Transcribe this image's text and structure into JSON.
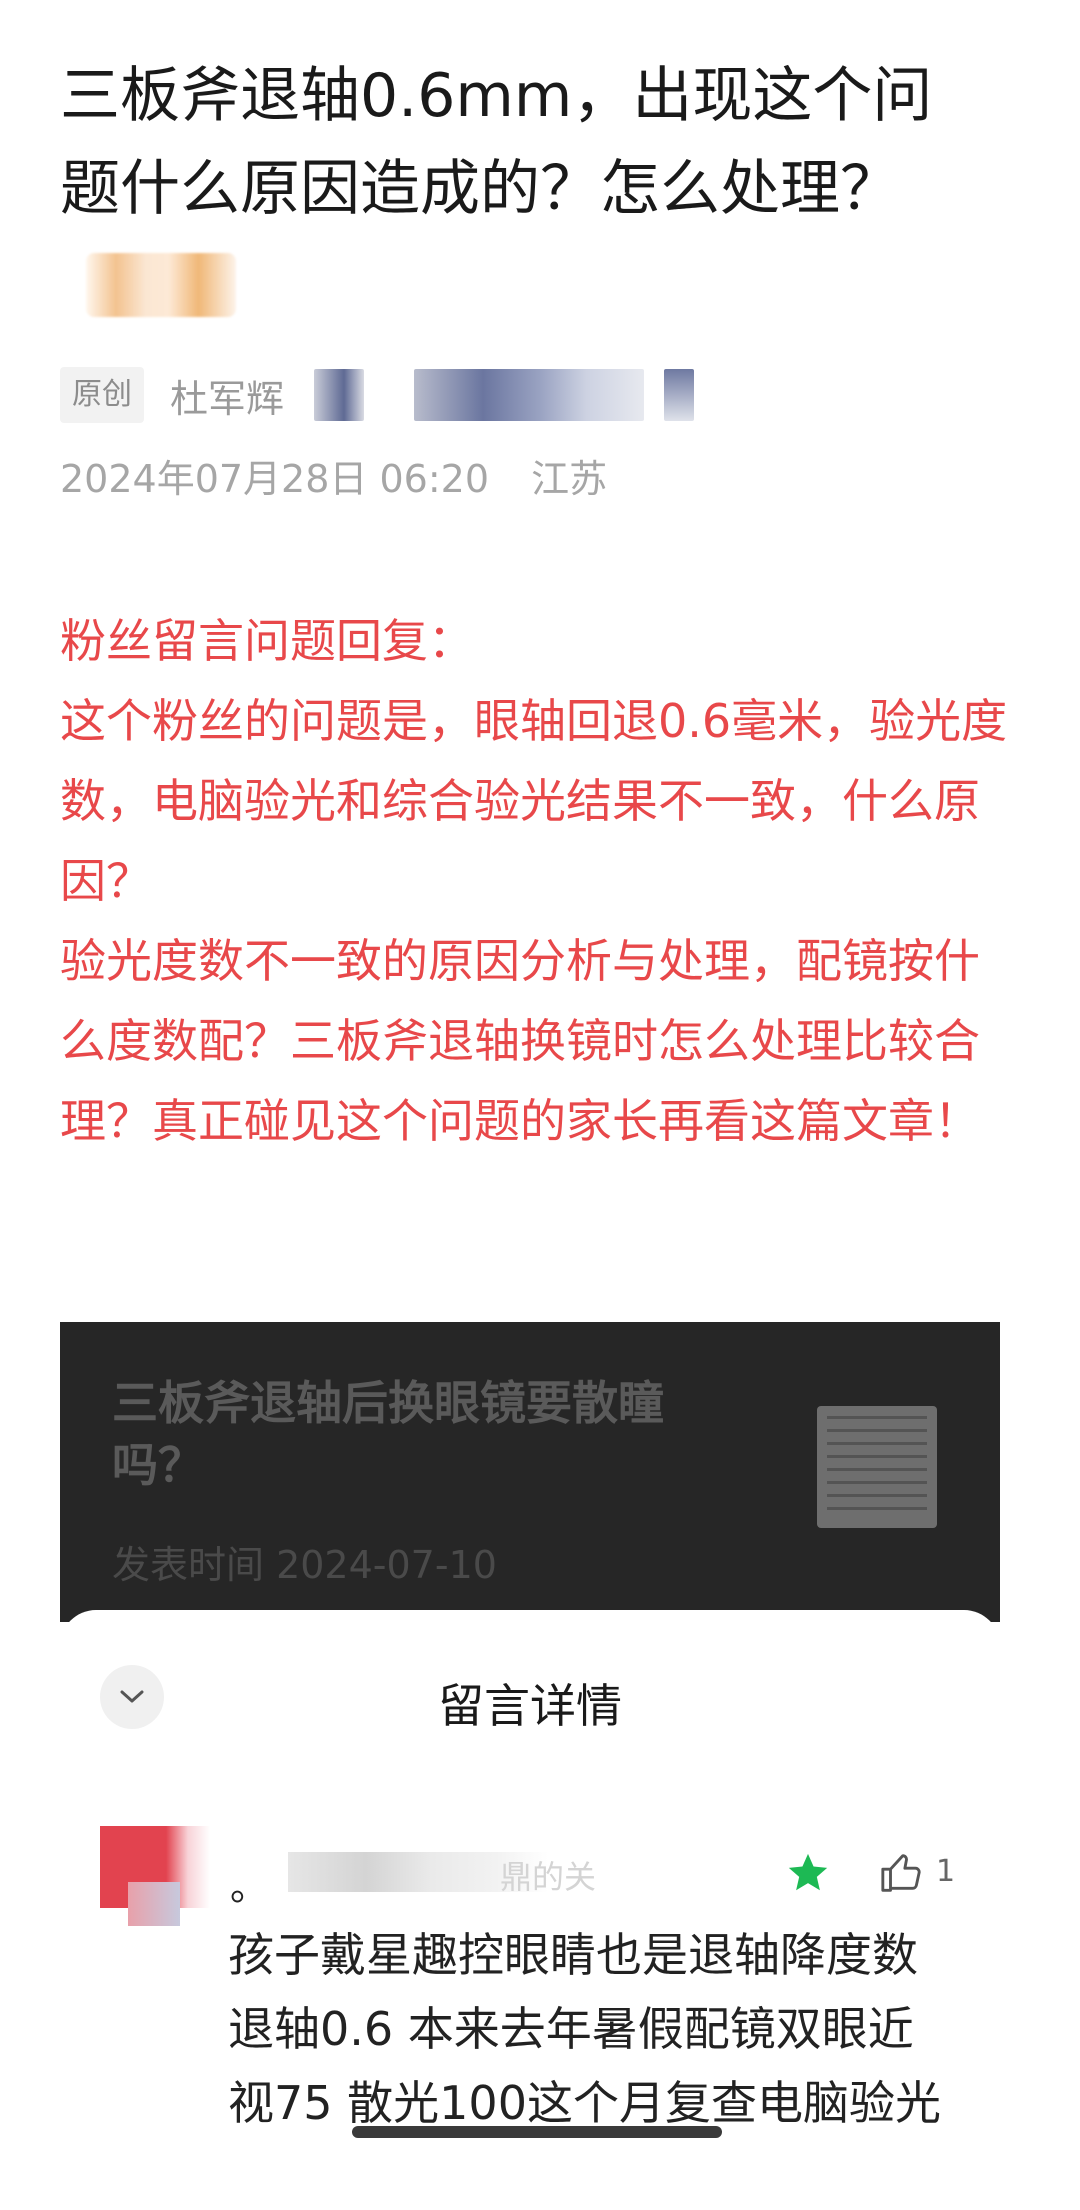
{
  "article": {
    "title": "三板斧退轴0.6mm，出现这个问题什么原因造成的？怎么处理？",
    "badge": "原创",
    "author": "杜军辉",
    "date": "2024年07月28日 06:20",
    "location": "江苏"
  },
  "body": {
    "lines": [
      "粉丝留言问题回复：",
      "这个粉丝的问题是，眼轴回退0.6毫米，验光度数，电脑验光和综合验光结果不一致，什么原因？",
      "验光度数不一致的原因分析与处理，配镜按什么度数配？三板斧退轴换镜时怎么处理比较合理？真正碰见这个问题的家长再看这篇文章！"
    ]
  },
  "linked_card": {
    "title": "三板斧退轴后换眼镜要散瞳吗？",
    "date": "发表时间 2024-07-10"
  },
  "comment_sheet": {
    "title": "留言详情",
    "comment": {
      "prefix": "。",
      "nickname_tail": "鼎的关",
      "like_count": "1",
      "text": "孩子戴星趣控眼睛也是退轴降度数 退轴0.6 本来去年暑假配镜双眼近视75 散光100这个月复查电脑验光"
    }
  },
  "colors": {
    "accent_red": "#e8484a",
    "star_green": "#1db954"
  }
}
